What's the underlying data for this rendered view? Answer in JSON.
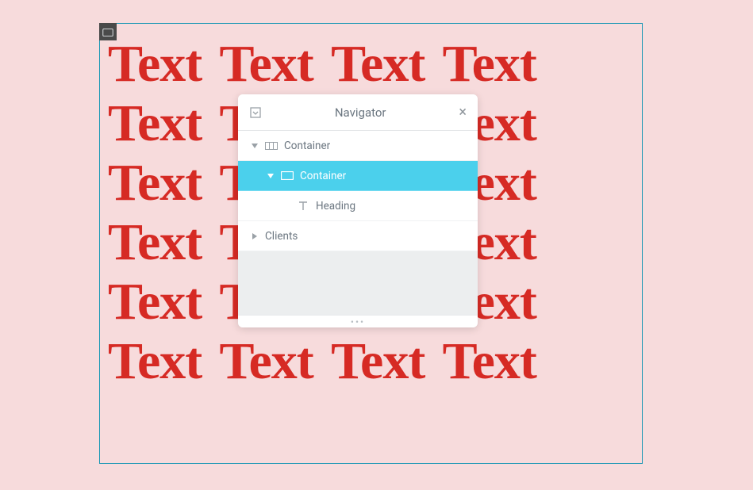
{
  "canvas": {
    "text_content": "Text Text Text Text Text Text Text Text Text Text Text Text Text Text Text Text Text Text Text Text Text Text Text Text"
  },
  "navigator": {
    "title": "Navigator",
    "tree": [
      {
        "label": "Container"
      },
      {
        "label": "Container"
      },
      {
        "label": "Heading"
      },
      {
        "label": "Clients"
      }
    ]
  },
  "colors": {
    "accent_cyan": "#4bd0ec",
    "text_red": "#d62a24",
    "bg_pink": "#f7dbdc",
    "frame_teal": "#1c98b5"
  }
}
